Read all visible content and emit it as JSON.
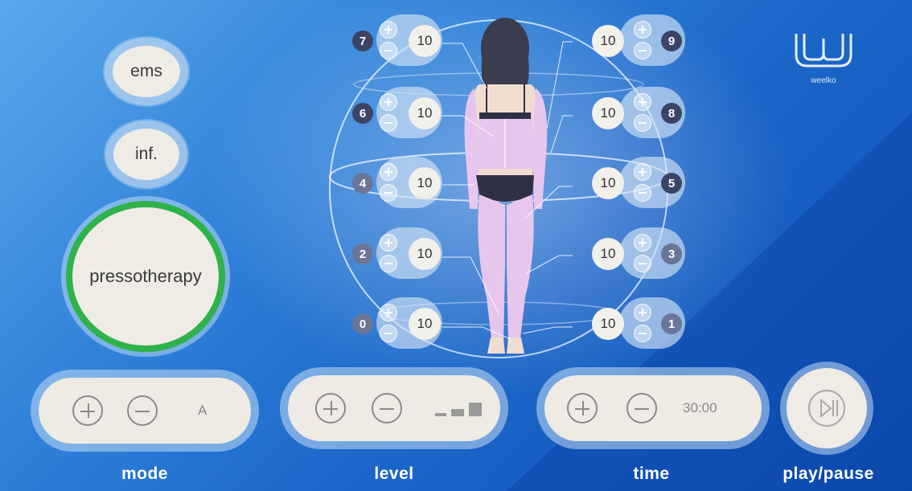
{
  "sidebar": {
    "ems_label": "ems",
    "inf_label": "inf.",
    "pressotherapy_label": "pressotherapy"
  },
  "logo": {
    "text": "weelko",
    "icon": "weelko-logo-icon"
  },
  "channels": [
    {
      "id": "7",
      "value": "10",
      "side": "left",
      "dark": true
    },
    {
      "id": "6",
      "value": "10",
      "side": "left",
      "dark": true
    },
    {
      "id": "4",
      "value": "10",
      "side": "left",
      "dark": false
    },
    {
      "id": "2",
      "value": "10",
      "side": "left",
      "dark": false
    },
    {
      "id": "0",
      "value": "10",
      "side": "left",
      "dark": false
    },
    {
      "id": "9",
      "value": "10",
      "side": "right",
      "dark": true
    },
    {
      "id": "8",
      "value": "10",
      "side": "right",
      "dark": true
    },
    {
      "id": "5",
      "value": "10",
      "side": "right",
      "dark": true
    },
    {
      "id": "3",
      "value": "10",
      "side": "right",
      "dark": false
    },
    {
      "id": "1",
      "value": "10",
      "side": "right",
      "dark": false
    }
  ],
  "controls": {
    "mode": {
      "label": "mode",
      "value": "A"
    },
    "level": {
      "label": "level",
      "level_fraction": 1.0
    },
    "time": {
      "label": "time",
      "value": "30:00"
    },
    "play": {
      "label": "play/pause",
      "icon": "play-pause-icon"
    }
  },
  "colors": {
    "accent_green": "#2fb24a",
    "button_bg": "#efece6",
    "channel_badge": "#3c4466",
    "body_zone": "#e7c6ee"
  }
}
